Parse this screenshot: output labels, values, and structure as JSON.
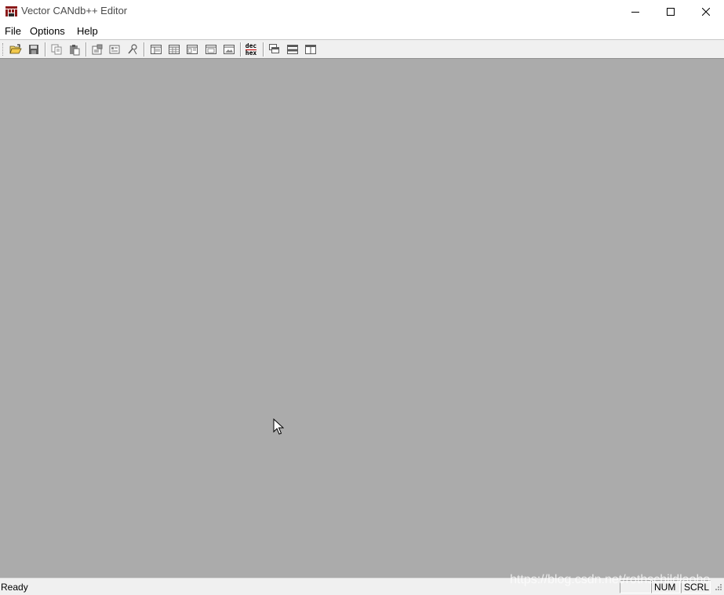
{
  "window": {
    "title": "Vector CANdb++ Editor",
    "icon": "candb-app-icon",
    "controls": [
      "minimize-icon",
      "maximize-icon",
      "close-icon"
    ]
  },
  "menu": {
    "items": [
      "File",
      "Options",
      "Help"
    ]
  },
  "toolbar": {
    "dec_label": "dec",
    "hex_label": "hex",
    "buttons": [
      "open-folder-icon",
      "save-icon",
      "copy-icon",
      "paste-icon",
      "properties-icon",
      "list-view-icon",
      "network-node-icon",
      "overview-icon",
      "grid-view-icon",
      "detail-view-icon",
      "window-view-icon",
      "picture-view-icon",
      "dec-hex-toggle-icon",
      "cascade-windows-icon",
      "tile-horizontal-icon",
      "tile-vertical-icon"
    ]
  },
  "status": {
    "text": "Ready",
    "num": "NUM",
    "scrl": "SCRL"
  },
  "watermark": "https://blog.csdn.net/rothschildlaoho",
  "colors": {
    "client_bg": "#ababab",
    "toolbar_bg": "#f0f0f0",
    "titlebar_bg": "#ffffff"
  }
}
